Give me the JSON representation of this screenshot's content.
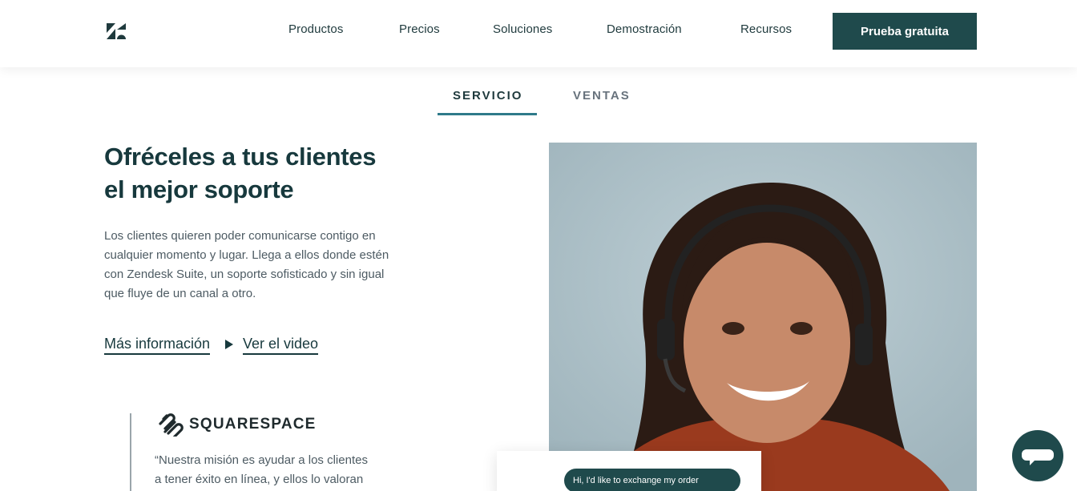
{
  "header": {
    "logo_icon": "zendesk-logo-icon",
    "nav": [
      {
        "label": "Productos"
      },
      {
        "label": "Precios"
      },
      {
        "label": "Soluciones"
      },
      {
        "label": "Demostración"
      },
      {
        "label": "Recursos"
      }
    ],
    "cta_label": "Prueba gratuita"
  },
  "tabs": [
    {
      "label": "SERVICIO",
      "active": true
    },
    {
      "label": "VENTAS",
      "active": false
    }
  ],
  "main": {
    "headline_line1": "Ofréceles a tus clientes",
    "headline_line2": "el mejor soporte",
    "body": "Los clientes quieren poder comunicarse contigo en cualquier momento y lugar. Llega a ellos donde estén con Zendesk Suite, un soporte sofisticado y sin igual que fluye de un canal a otro.",
    "link_more": "Más información",
    "link_video": "Ver el video",
    "video_icon": "play-icon"
  },
  "testimonial": {
    "brand": "SQUARESPACE",
    "brand_icon": "squarespace-logo-icon",
    "quote_line1": "“Nuestra misión es ayudar a los clientes",
    "quote_line2": " a tener éxito en línea, y ellos lo valoran"
  },
  "hero": {
    "chat_message": "Hi, I'd like to exchange my order"
  },
  "widget": {
    "icon": "chat-bubble-icon"
  },
  "colors": {
    "brand_dark": "#1f4a4c",
    "tab_accent": "#2f7a8a",
    "heading": "#17393d",
    "body_text": "#4d5b63"
  }
}
